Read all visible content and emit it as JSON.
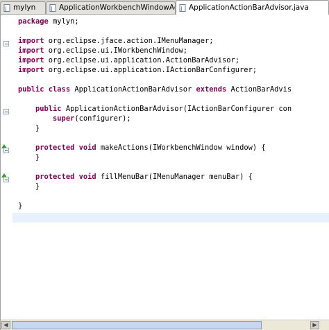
{
  "tabs": [
    {
      "label": "mylyn",
      "icon": "java-file-icon",
      "active": false
    },
    {
      "label": "ApplicationWorkbenchWindowAdvis",
      "icon": "java-file-icon",
      "active": false
    },
    {
      "label": "ApplicationActionBarAdvisor.java",
      "icon": "java-file-icon",
      "active": true
    }
  ],
  "editor": {
    "lines": [
      {
        "kw": "package",
        "rest": " mylyn;"
      },
      {
        "kw": "",
        "rest": ""
      },
      {
        "kw": "import",
        "rest": " org.eclipse.jface.action.IMenuManager;"
      },
      {
        "kw": "import",
        "rest": " org.eclipse.ui.IWorkbenchWindow;"
      },
      {
        "kw": "import",
        "rest": " org.eclipse.ui.application.ActionBarAdvisor;"
      },
      {
        "kw": "import",
        "rest": " org.eclipse.ui.application.IActionBarConfigurer;"
      },
      {
        "kw": "",
        "rest": ""
      },
      {
        "kw": "public class",
        "rest": " ApplicationActionBarAdvisor ",
        "kw2": "extends",
        "rest2": " ActionBarAdvis"
      },
      {
        "kw": "",
        "rest": ""
      },
      {
        "indent": "    ",
        "kw": "public",
        "rest": " ApplicationActionBarAdvisor(IActionBarConfigurer con"
      },
      {
        "indent": "        ",
        "kw": "super",
        "rest": "(configurer);"
      },
      {
        "indent": "    ",
        "kw": "",
        "rest": "}"
      },
      {
        "kw": "",
        "rest": ""
      },
      {
        "indent": "    ",
        "kw": "protected void",
        "rest": " makeActions(IWorkbenchWindow window) {"
      },
      {
        "indent": "    ",
        "kw": "",
        "rest": "}"
      },
      {
        "kw": "",
        "rest": ""
      },
      {
        "indent": "    ",
        "kw": "protected void",
        "rest": " fillMenuBar(IMenuManager menuBar) {"
      },
      {
        "indent": "    ",
        "kw": "",
        "rest": "}"
      },
      {
        "kw": "",
        "rest": ""
      },
      {
        "kw": "",
        "rest": "}"
      },
      {
        "kw": "",
        "rest": ""
      }
    ]
  },
  "colors": {
    "keyword": "#7f0055",
    "current_line": "#e8f2fe",
    "override_marker": "#2f9a2f"
  }
}
